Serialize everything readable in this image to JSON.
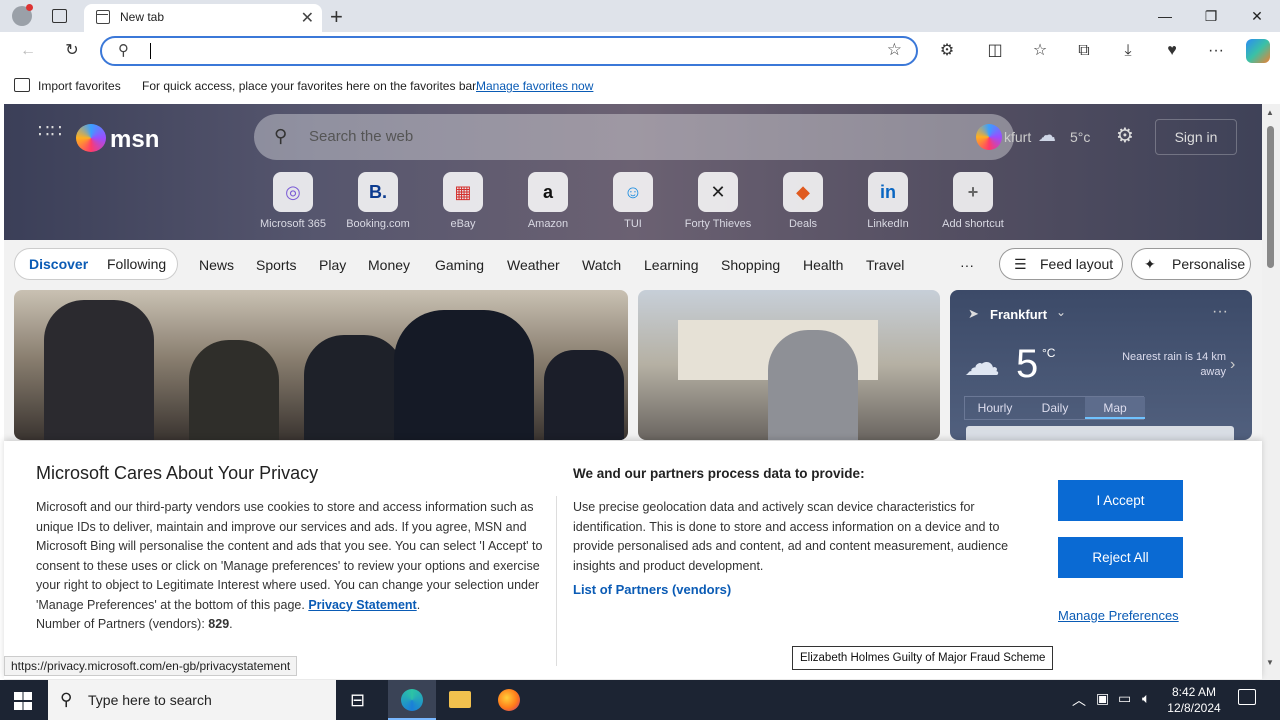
{
  "browser": {
    "tab_title": "New tab",
    "address_value": "",
    "favorites_bar": {
      "import_label": "Import favorites",
      "message": "For quick access, place your favorites here on the favorites bar.",
      "manage_link": "Manage favorites now"
    }
  },
  "msn": {
    "logo_text": "msn",
    "search_placeholder": "Search the web",
    "location_short": "kfurt",
    "temp_top": "5°c",
    "sign_in": "Sign in",
    "shortcuts": [
      {
        "label": "Microsoft 365",
        "glyph": "◎",
        "color": "#7b5cd6"
      },
      {
        "label": "Booking.com",
        "glyph": "B.",
        "color": "#0c3b8f"
      },
      {
        "label": "eBay",
        "glyph": "▦",
        "color": "#d4302d"
      },
      {
        "label": "Amazon",
        "glyph": "a",
        "color": "#111111"
      },
      {
        "label": "TUI",
        "glyph": "☺",
        "color": "#1a8ce0"
      },
      {
        "label": "Forty Thieves",
        "glyph": "✕",
        "color": "#222222"
      },
      {
        "label": "Deals",
        "glyph": "◆",
        "color": "#e05a1f"
      },
      {
        "label": "LinkedIn",
        "glyph": "in",
        "color": "#0a66c2"
      },
      {
        "label": "Add shortcut",
        "glyph": "+",
        "color": "#666666"
      }
    ],
    "nav": {
      "discover": "Discover",
      "following": "Following",
      "items": [
        "News",
        "Sports",
        "Play",
        "Money",
        "Gaming",
        "Weather",
        "Watch",
        "Learning",
        "Shopping",
        "Health",
        "Travel"
      ],
      "more": "···",
      "feed_layout": "Feed layout",
      "personalise": "Personalise"
    },
    "weather": {
      "city": "Frankfurt",
      "temp": "5",
      "unit": "°C",
      "rain": "Nearest rain is 14 km away",
      "tabs": [
        "Hourly",
        "Daily",
        "Map"
      ]
    }
  },
  "privacy": {
    "title": "Microsoft Cares About Your Privacy",
    "body": "Microsoft and our third-party vendors use cookies to store and access information such as unique IDs to deliver, maintain and improve our services and ads. If you agree, MSN and Microsoft Bing will personalise the content and ads that you see. You can select 'I Accept' to consent to these uses or click on 'Manage preferences' to review your options and exercise your right to object to Legitimate Interest where used.  You can change your selection under 'Manage Preferences' at the bottom of this page.",
    "privacy_link": "Privacy Statement",
    "partners_label": "Number of Partners (vendors):",
    "partners_count": "829",
    "right_title": "We and our partners process data to provide:",
    "right_body": "Use precise geolocation data and actively scan device characteristics for identification. This is done to store and access information on a device and to provide personalised ads and content, ad and content measurement, audience insights and product development.",
    "partners_link": "List of Partners (vendors)",
    "accept": "I Accept",
    "reject": "Reject All",
    "manage": "Manage Preferences"
  },
  "status_url": "https://privacy.microsoft.com/en-gb/privacystatement",
  "tooltip": "Elizabeth Holmes Guilty of Major Fraud Scheme",
  "taskbar": {
    "search_placeholder": "Type here to search",
    "time": "8:42 AM",
    "date": "12/8/2024"
  }
}
